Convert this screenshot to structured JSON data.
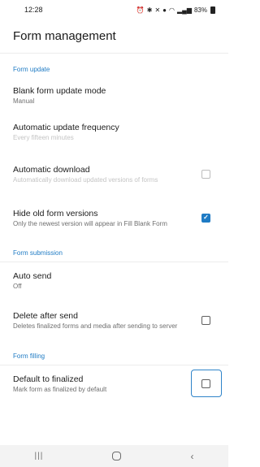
{
  "status_bar": {
    "time": "12:28",
    "battery": "83%",
    "icons": [
      "alarm-icon",
      "bluetooth-icon",
      "mute-icon",
      "location-icon",
      "wifi-icon",
      "signal-icon",
      "battery-icon"
    ]
  },
  "app_bar": {
    "title": "Form management"
  },
  "sections": [
    {
      "header": "Form update",
      "items": [
        {
          "title": "Blank form update mode",
          "summary": "Manual",
          "control": "none",
          "enabled": true
        },
        {
          "title": "Automatic update frequency",
          "summary": "Every fifteen minutes",
          "control": "none",
          "enabled": false
        },
        {
          "title": "Automatic download",
          "summary": "Automatically download updated versions of forms",
          "control": "checkbox",
          "checked": false,
          "enabled": false
        },
        {
          "title": "Hide old form versions",
          "summary": "Only the newest version will appear in Fill Blank Form",
          "control": "checkbox",
          "checked": true,
          "enabled": true
        }
      ]
    },
    {
      "header": "Form submission",
      "items": [
        {
          "title": "Auto send",
          "summary": "Off",
          "control": "none",
          "enabled": true
        },
        {
          "title": "Delete after send",
          "summary": "Deletes finalized forms and media after sending to server",
          "control": "checkbox",
          "checked": false,
          "enabled": true
        }
      ]
    },
    {
      "header": "Form filling",
      "items": [
        {
          "title": "Default to finalized",
          "summary": "Mark form as finalized by default",
          "control": "checkbox",
          "checked": false,
          "enabled": true,
          "focused": true
        }
      ]
    }
  ],
  "nav_bar": {
    "recents_icon": "recents-icon",
    "home_icon": "home-icon",
    "back_icon": "back-icon"
  },
  "colors": {
    "accent": "#1f7bc4",
    "text": "#1c1c1c",
    "summary": "#6f6f6f",
    "disabled": "#c4c4c4"
  }
}
